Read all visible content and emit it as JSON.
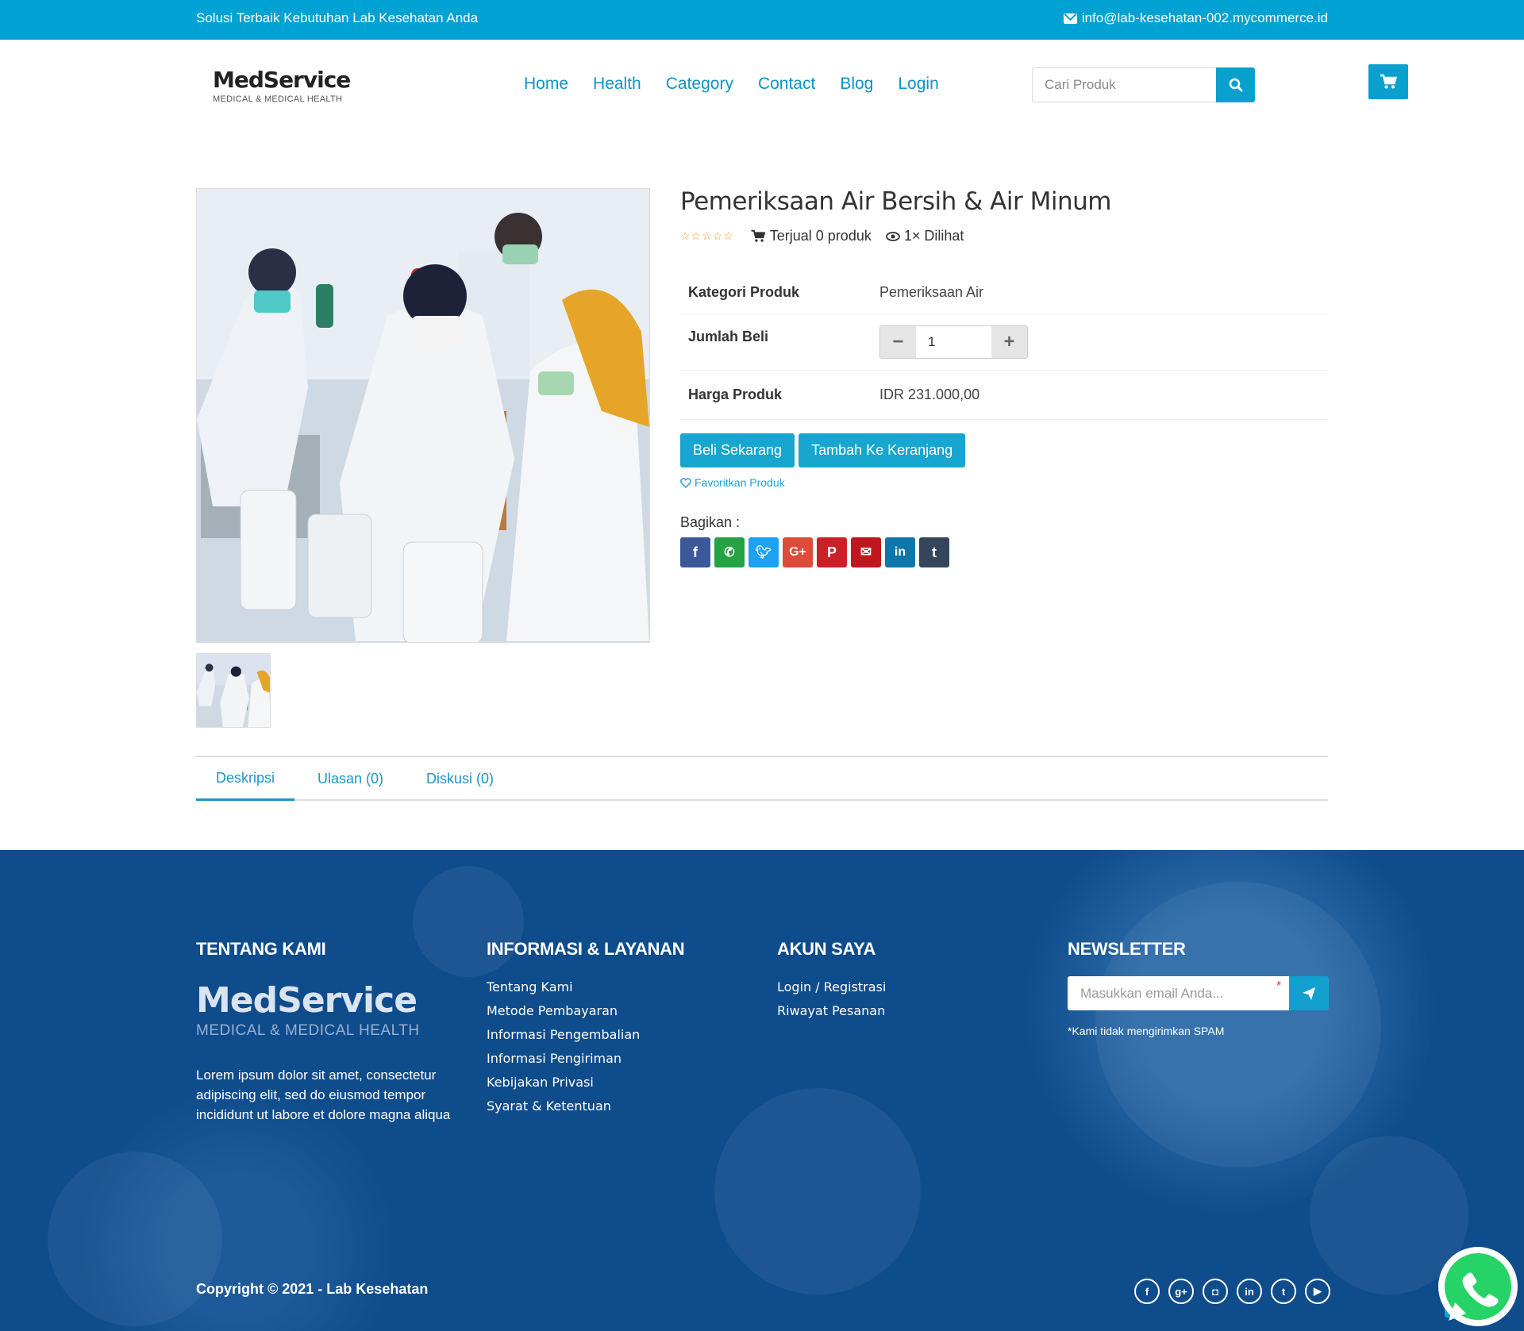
{
  "topbar": {
    "tagline": "Solusi Terbaik Kebutuhan Lab Kesehatan Anda",
    "email": "info@lab-kesehatan-002.mycommerce.id"
  },
  "header": {
    "logo_name": "MedService",
    "logo_tagline": "MEDICAL & MEDICAL HEALTH",
    "nav": [
      "Home",
      "Health",
      "Category",
      "Contact",
      "Blog",
      "Login"
    ],
    "search_placeholder": "Cari Produk"
  },
  "product": {
    "title": "Pemeriksaan Air Bersih & Air Minum",
    "rating_stars": 0,
    "sold": "Terjual 0 produk",
    "views": "1× Dilihat",
    "rows": {
      "category_label": "Kategori Produk",
      "category_value": "Pemeriksaan Air",
      "qty_label": "Jumlah Beli",
      "qty_value": "1",
      "price_label": "Harga Produk",
      "price_value": "IDR 231.000,00"
    },
    "buy_now": "Beli Sekarang",
    "add_to_cart": "Tambah Ke Keranjang",
    "favorite": "Favoritkan Produk",
    "share_label": "Bagikan :",
    "share_buttons": [
      {
        "icon": "facebook-icon",
        "color": "#3b5998"
      },
      {
        "icon": "whatsapp-icon",
        "color": "#25a243"
      },
      {
        "icon": "twitter-icon",
        "color": "#1da1f2"
      },
      {
        "icon": "google-plus-icon",
        "color": "#dd4b39"
      },
      {
        "icon": "pinterest-icon",
        "color": "#cb2027"
      },
      {
        "icon": "email-icon",
        "color": "#c0171f"
      },
      {
        "icon": "linkedin-icon",
        "color": "#0e76a8"
      },
      {
        "icon": "tumblr-icon",
        "color": "#35465c"
      }
    ]
  },
  "tabs": [
    "Deskripsi",
    "Ulasan (0)",
    "Diskusi (0)"
  ],
  "footer": {
    "about": {
      "title": "TENTANG KAMI",
      "logo_name": "MedService",
      "logo_tagline": "MEDICAL & MEDICAL HEALTH",
      "text": "Lorem ipsum dolor sit amet, consectetur adipiscing elit, sed do eiusmod tempor incididunt ut labore et dolore magna aliqua"
    },
    "info": {
      "title": "INFORMASI & LAYANAN",
      "links": [
        "Tentang Kami",
        "Metode Pembayaran",
        "Informasi Pengembalian",
        "Informasi Pengiriman",
        "Kebijakan Privasi",
        "Syarat & Ketentuan"
      ]
    },
    "account": {
      "title": "AKUN SAYA",
      "links": [
        "Login / Registrasi",
        "Riwayat Pesanan"
      ]
    },
    "newsletter": {
      "title": "NEWSLETTER",
      "placeholder": "Masukkan email Anda...",
      "note": "*Kami tidak mengirimkan SPAM"
    },
    "copyright": "Copyright © 2021 - Lab Kesehatan"
  }
}
